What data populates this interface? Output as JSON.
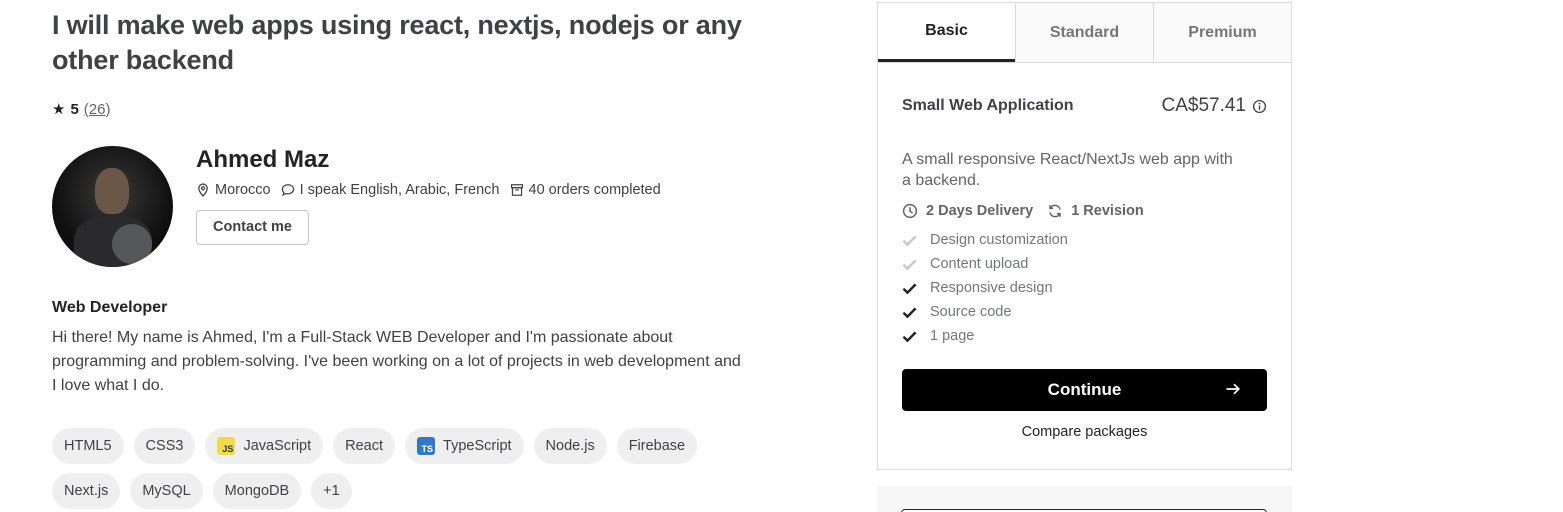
{
  "gig": {
    "title": "I will make web apps using react, nextjs, nodejs or any other backend",
    "rating": "5",
    "review_count": "(26)"
  },
  "seller": {
    "name": "Ahmed Maz",
    "location": "Morocco",
    "languages": "I speak English, Arabic, French",
    "orders": "40 orders completed",
    "contact_label": "Contact me",
    "headline": "Web Developer",
    "bio": "Hi there! My name is Ahmed, I'm a Full-Stack WEB Developer and I'm passionate about programming and problem-solving. I've been working on a lot of projects in web development and I love what I do."
  },
  "skills": [
    {
      "label": "HTML5",
      "logo": ""
    },
    {
      "label": "CSS3",
      "logo": ""
    },
    {
      "label": "JavaScript",
      "logo": "JS"
    },
    {
      "label": "React",
      "logo": ""
    },
    {
      "label": "TypeScript",
      "logo": "TS"
    },
    {
      "label": "Node.js",
      "logo": ""
    },
    {
      "label": "Firebase",
      "logo": ""
    },
    {
      "label": "Next.js",
      "logo": ""
    },
    {
      "label": "MySQL",
      "logo": ""
    },
    {
      "label": "MongoDB",
      "logo": ""
    },
    {
      "label": "+1",
      "logo": ""
    }
  ],
  "packages": {
    "tabs": [
      "Basic",
      "Standard",
      "Premium"
    ],
    "active_tab": "Basic",
    "name": "Small Web Application",
    "price": "CA$57.41",
    "description": "A small responsive React/NextJs web app with a backend.",
    "delivery": "2 Days Delivery",
    "revisions": "1 Revision",
    "features": [
      {
        "label": "Design customization",
        "included": false
      },
      {
        "label": "Content upload",
        "included": false
      },
      {
        "label": "Responsive design",
        "included": true
      },
      {
        "label": "Source code",
        "included": true
      },
      {
        "label": "1 page",
        "included": true
      }
    ],
    "continue_label": "Continue",
    "compare_label": "Compare packages"
  },
  "colors": {
    "included_check": "#222325",
    "excluded_check": "#c5c6c9",
    "button_bg": "#000000"
  },
  "icons": {
    "rating": "star-icon",
    "location": "location-pin-icon",
    "languages": "chat-bubble-icon",
    "orders": "box-icon",
    "price_info": "info-icon",
    "delivery": "clock-icon",
    "revisions": "refresh-icon",
    "feature": "check-icon",
    "continue": "arrow-right-icon"
  }
}
